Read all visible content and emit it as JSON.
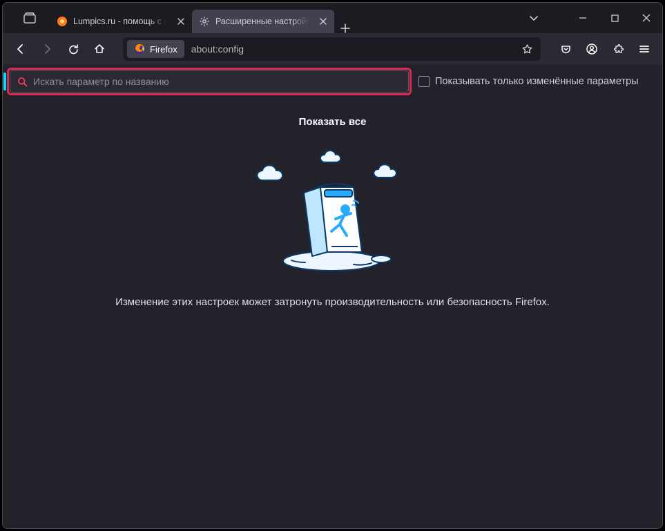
{
  "tabs": [
    {
      "title": "Lumpics.ru - помощь с компьютером"
    },
    {
      "title": "Расширенные настройки"
    }
  ],
  "urlbar": {
    "badge": "Firefox",
    "address": "about:config"
  },
  "config": {
    "search_placeholder": "Искать параметр по названию",
    "only_modified_label": "Показывать только изменённые параметры",
    "show_all": "Показать все",
    "warning": "Изменение этих настроек может затронуть производительность или безопасность Firefox."
  }
}
